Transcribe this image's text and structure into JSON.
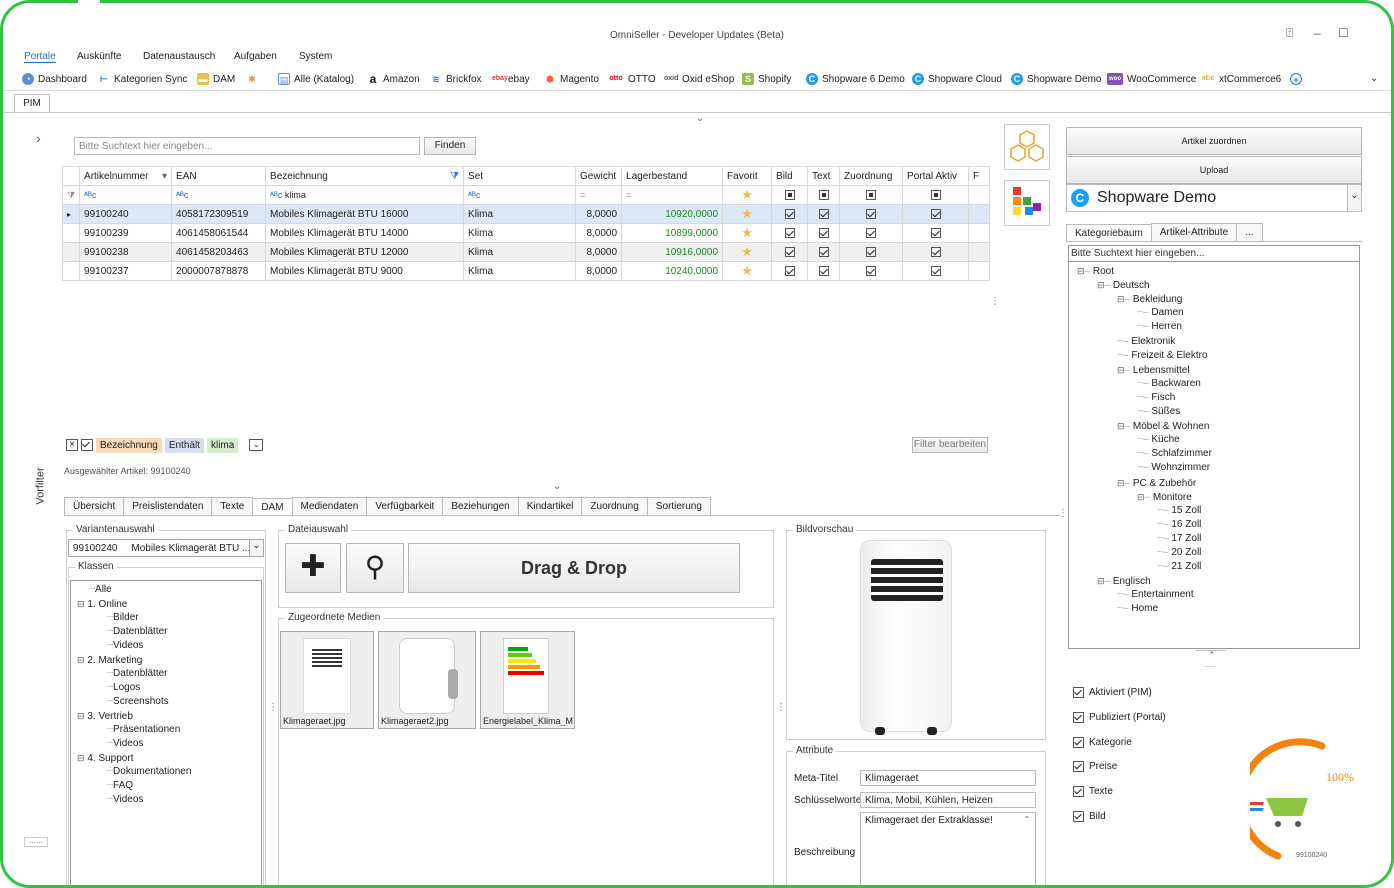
{
  "window": {
    "title": "OmniSeller - Developer Updates (Beta)"
  },
  "menu": [
    "Portale",
    "Auskünfte",
    "Datenaustausch",
    "Aufgaben",
    "System"
  ],
  "portals": [
    "Dashboard",
    "Kategorien Sync",
    "DAM",
    "Alle (Katalog)",
    "Amazon",
    "Brickfox",
    "ebay",
    "Magento",
    "OTTO",
    "Oxid eShop",
    "Shopify",
    "Shopware 6 Demo",
    "Shopware Cloud",
    "Shopware Demo",
    "WooCommerce",
    "xtCommerce6"
  ],
  "doc_tab": "PIM",
  "left": {
    "vorfilter": "Vorfilter",
    "collapse": "......"
  },
  "search": {
    "placeholder": "Bitte Suchtext hier eingeben...",
    "button": "Finden"
  },
  "grid": {
    "columns": [
      "Artikelnummer",
      "EAN",
      "Bezeichnung",
      "Set",
      "Gewicht",
      "Lagerbestand",
      "Favorit",
      "Bild",
      "Text",
      "Zuordnung",
      "Portal Aktiv",
      "F"
    ],
    "filter_text": "klima",
    "rows": [
      {
        "nr": "99100240",
        "ean": "4058172309519",
        "name": "Mobiles Klimagerät BTU 16000",
        "set": "Klima",
        "weight": "8,0000",
        "stock": "10920,0000"
      },
      {
        "nr": "99100239",
        "ean": "4061458061544",
        "name": "Mobiles Klimagerät BTU 14000",
        "set": "Klima",
        "weight": "8,0000",
        "stock": "10899,0000"
      },
      {
        "nr": "99100238",
        "ean": "4061458203463",
        "name": "Mobiles Klimagerät BTU 12000",
        "set": "Klima",
        "weight": "8,0000",
        "stock": "10916,0000"
      },
      {
        "nr": "99100237",
        "ean": "2000007878878",
        "name": "Mobiles Klimagerät BTU 9000",
        "set": "Klima",
        "weight": "8,0000",
        "stock": "10240,0000"
      }
    ]
  },
  "filter": {
    "field": "Bezeichnung",
    "op": "Enthält",
    "value": "klima",
    "edit": "Filter bearbeiten",
    "selected": "Ausgewählter Artikel: 99100240"
  },
  "detail_tabs": [
    "Übersicht",
    "Preislistendaten",
    "Texte",
    "DAM",
    "Mediendaten",
    "Verfügbarkeit",
    "Beziehungen",
    "Kindartikel",
    "Zuordnung",
    "Sortierung"
  ],
  "dam": {
    "variant_label": "Variantenauswahl",
    "variant_value": "99100240     Mobiles Klimagerät BTU ...",
    "classes_label": "Klassen",
    "classes": [
      "Alle",
      "1. Online",
      "Bilder",
      "Datenblätter",
      "Videos",
      "2. Marketing",
      "Datenblätter",
      "Logos",
      "Screenshots",
      "3. Vertrieb",
      "Präsentationen",
      "Videos",
      "4. Support",
      "Dokumentationen",
      "FAQ",
      "Videos"
    ],
    "file_label": "Dateiauswahl",
    "dragdrop": "Drag & Drop",
    "media_label": "Zugeordnete Medien",
    "media": [
      "Klimageraet.jpg",
      "Klimageraet2.jpg",
      "Energielabel_Klima_M"
    ],
    "preview_label": "Bildvorschau",
    "attr_label": "Attribute",
    "meta_label": "Meta-Titel",
    "meta_value": "Klimageraet",
    "keys_label": "Schlüsselworte",
    "keys_value": "Klima, Mobil, Kühlen, Heizen",
    "desc_label": "Beschreibung",
    "desc_value": "Klimageraet der Extraklasse!"
  },
  "right": {
    "assign": "Artikel zuordnen",
    "upload": "Upload",
    "shop": "Shopware Demo",
    "tabs": [
      "Kategoriebaum",
      "Artikel-Attribute",
      "..."
    ],
    "search_placeholder": "Bitte Suchtext hier eingeben...",
    "tree": [
      "Root",
      "Deutsch",
      "Bekleidung",
      "Damen",
      "Herren",
      "Elektronik",
      "Freizeit & Elektro",
      "Lebensmittel",
      "Backwaren",
      "Fisch",
      "Süßes",
      "Möbel & Wohnen",
      "Küche",
      "Schlafzimmer",
      "Wohnzimmer",
      "PC & Zubehör",
      "Monitore",
      "15 Zoll",
      "16 Zoll",
      "17 Zoll",
      "20 Zoll",
      "21 Zoll",
      "Englisch",
      "Entertainment",
      "Home"
    ],
    "checks": [
      "Aktiviert (PIM)",
      "Publiziert (Portal)",
      "Kategorie",
      "Preise",
      "Texte",
      "Bild"
    ],
    "percent": "100%",
    "progress": 1.0,
    "article": "99100240"
  },
  "colors": {
    "accent": "#1f6fd0",
    "frame": "#2fc53f",
    "progress": "#f5820f",
    "stock": "#1a8a1a"
  }
}
